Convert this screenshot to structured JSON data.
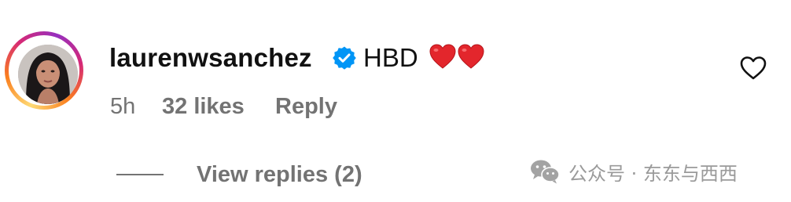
{
  "comment": {
    "username": "laurenwsanchez",
    "text": "HBD",
    "emoji": "red-heart-emoji x2",
    "verified_icon": "verified-badge-icon",
    "like_icon": "heart-outline-icon"
  },
  "meta": {
    "time": "5h",
    "likes": "32 likes",
    "reply": "Reply"
  },
  "replies": {
    "label": "View replies (2)"
  },
  "watermark": {
    "text": "公众号 · 东东与西西",
    "icon": "wechat-icon"
  },
  "colors": {
    "text": "#111111",
    "secondary": "#737373",
    "verified": "#0095f6",
    "heart": "#e0245e",
    "watermark": "#9a9a9a"
  }
}
